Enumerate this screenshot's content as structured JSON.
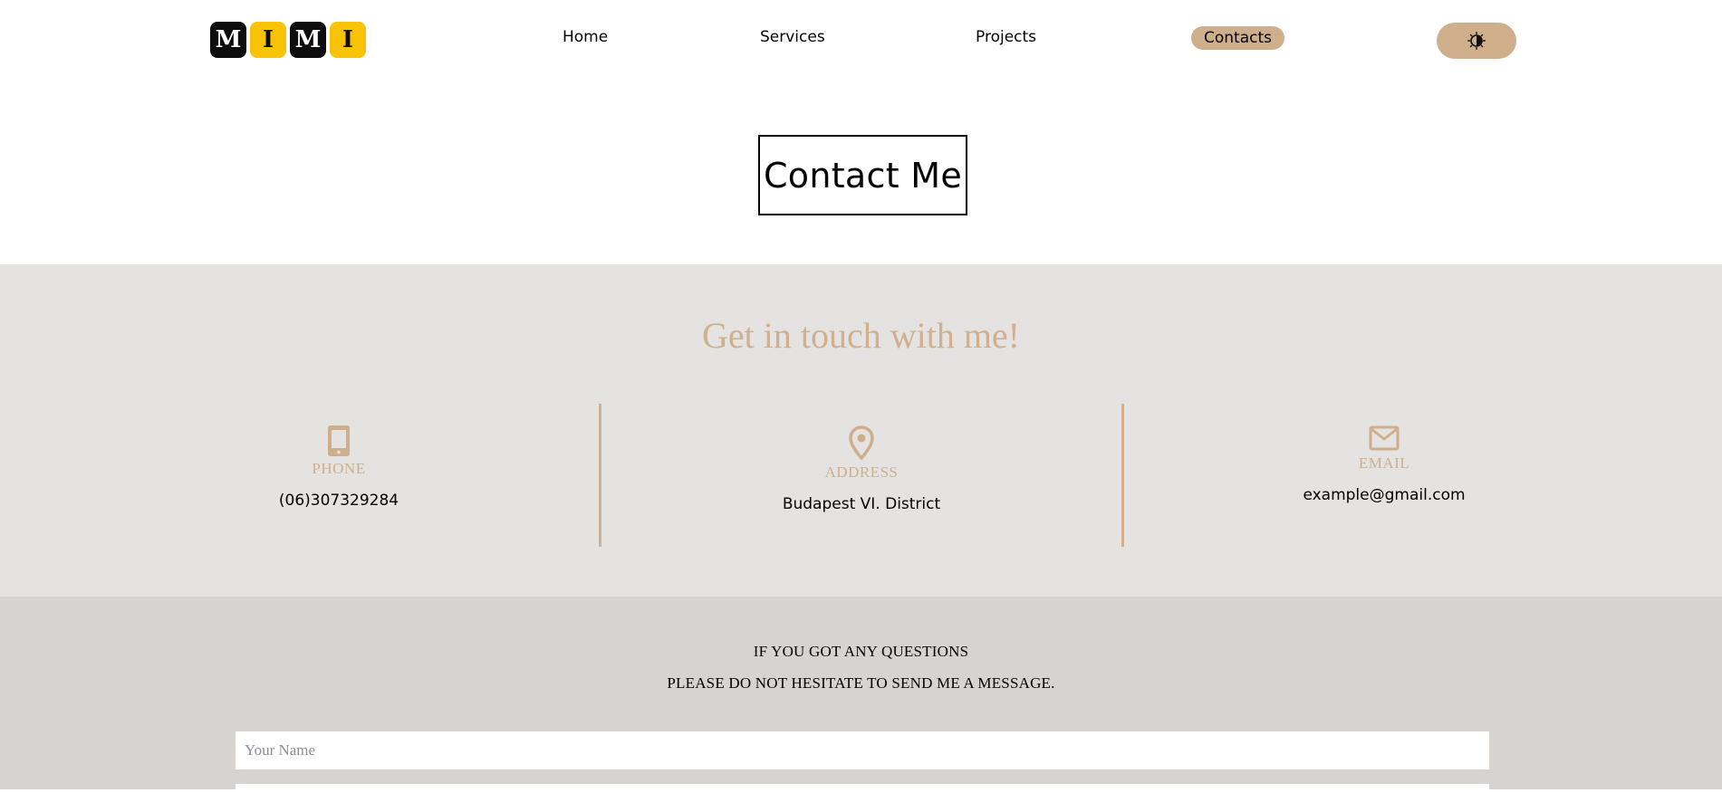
{
  "logo": {
    "letters": [
      "M",
      "I",
      "M",
      "I"
    ]
  },
  "nav": {
    "home": "Home",
    "services": "Services",
    "projects": "Projects",
    "contacts": "Contacts",
    "active": "Contacts"
  },
  "theme_toggle": {
    "icon": "brightness-contrast-icon"
  },
  "page_title": "Contact Me",
  "info": {
    "heading": "Get in touch with me!",
    "phone": {
      "icon": "phone-icon",
      "label": "PHONE",
      "value": "(06)307329284"
    },
    "address": {
      "icon": "location-pin-icon",
      "label": "ADDRESS",
      "value": "Budapest VI. District"
    },
    "email": {
      "icon": "envelope-icon",
      "label": "EMAIL",
      "value": "example@gmail.com"
    }
  },
  "message": {
    "line1": "IF YOU GOT ANY QUESTIONS",
    "line2": "PLEASE DO NOT HESITATE TO SEND ME A MESSAGE.",
    "name_placeholder": "Your Name",
    "name_value": ""
  },
  "colors": {
    "accent": "#cfae8c",
    "info_bg": "#e5e3e1",
    "message_bg": "#d7d3d0",
    "logo_dark": "#0d0d0d",
    "logo_yellow": "#f8c304"
  }
}
